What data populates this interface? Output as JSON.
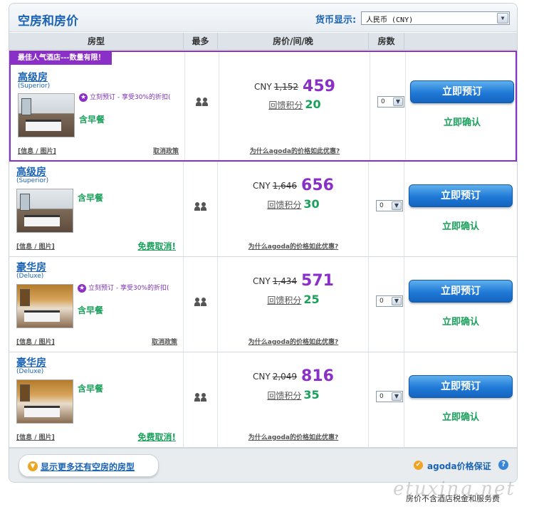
{
  "header": {
    "title": "空房和房价",
    "currency_label": "货币显示:",
    "currency_value": "人民币 (CNY)"
  },
  "columns": [
    "房型",
    "最多",
    "房价/间/晚",
    "房数",
    ""
  ],
  "featured_badge": "最佳人气酒店---数量有限！",
  "rooms": [
    {
      "name": "高级房",
      "sub": "(Superior)",
      "promo": "立刻预订 - 享受30%的折扣(",
      "meal": "含早餐",
      "info_link": "[信息 / 图片]",
      "cancel_link": "取消政策",
      "free_cancel": "",
      "currency": "CNY",
      "old_price": "1,152",
      "new_price": "459",
      "points_label": "回馈积分",
      "points": "20",
      "why_link": "为什么agoda的价格如此优惠?",
      "qty": "0",
      "book": "立即预订",
      "confirm": "立即确认"
    },
    {
      "name": "高级房",
      "sub": "(Superior)",
      "promo": "",
      "meal": "含早餐",
      "info_link": "[信息 / 图片]",
      "cancel_link": "",
      "free_cancel": "免费取消!",
      "currency": "CNY",
      "old_price": "1,646",
      "new_price": "656",
      "points_label": "回馈积分",
      "points": "30",
      "why_link": "为什么agoda的价格如此优惠?",
      "qty": "0",
      "book": "立即预订",
      "confirm": "立即确认"
    },
    {
      "name": "豪华房",
      "sub": "(Deluxe)",
      "promo": "立刻预订 - 享受30%的折扣(",
      "meal": "含早餐",
      "info_link": "[信息 / 图片]",
      "cancel_link": "取消政策",
      "free_cancel": "",
      "currency": "CNY",
      "old_price": "1,434",
      "new_price": "571",
      "points_label": "回馈积分",
      "points": "25",
      "why_link": "为什么agoda的价格如此优惠?",
      "qty": "0",
      "book": "立即预订",
      "confirm": "立即确认"
    },
    {
      "name": "豪华房",
      "sub": "(Deluxe)",
      "promo": "",
      "meal": "含早餐",
      "info_link": "[信息 / 图片]",
      "cancel_link": "",
      "free_cancel": "免费取消!",
      "currency": "CNY",
      "old_price": "2,049",
      "new_price": "816",
      "points_label": "回馈积分",
      "points": "35",
      "why_link": "为什么agoda的价格如此优惠?",
      "qty": "0",
      "book": "立即预订",
      "confirm": "立即确认"
    }
  ],
  "footer": {
    "more_rooms": "显示更多还有空房的房型",
    "guarantee": "agoda价格保证"
  },
  "footnote": "房价不含酒店税金和服务费",
  "watermark": "etuxing.net",
  "colors": {
    "accent_blue": "#1b63b4",
    "featured_purple": "#8b2fc9",
    "green": "#19a05a"
  }
}
